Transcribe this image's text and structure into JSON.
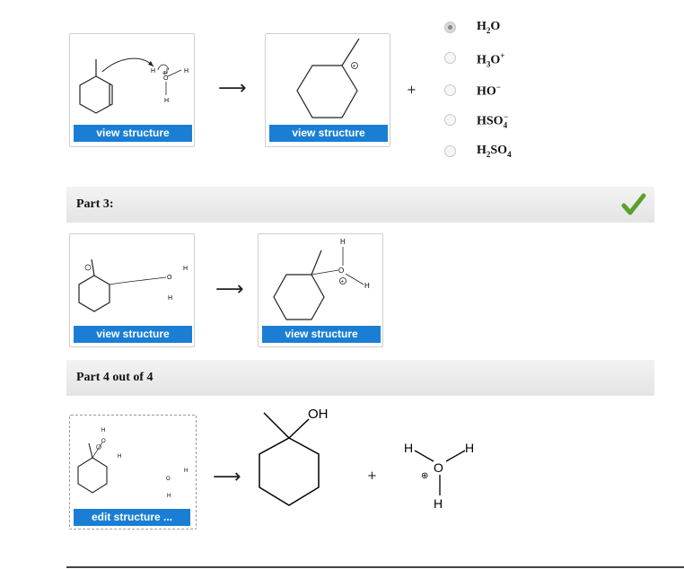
{
  "part2": {
    "reactant_card": {
      "button_label": "view structure"
    },
    "product_card": {
      "button_label": "view structure"
    },
    "arrow": "⟶",
    "plus": "+",
    "options": [
      {
        "base": "H",
        "sub": "2",
        "rest": "O",
        "sup": "",
        "checked": true
      },
      {
        "base": "H",
        "sub": "3",
        "rest": "O",
        "sup": "+",
        "checked": false
      },
      {
        "base": "HO",
        "sub": "",
        "rest": "",
        "sup": "−",
        "checked": false
      },
      {
        "base": "HSO",
        "sub": "4",
        "rest": "",
        "sup": "−",
        "checked": false
      },
      {
        "base": "H",
        "sub": "2",
        "rest": "SO",
        "sub2": "4",
        "checked": false
      }
    ]
  },
  "part3": {
    "title": "Part 3:",
    "status": "correct",
    "reactant_card": {
      "button_label": "view structure"
    },
    "product_card": {
      "button_label": "view structure"
    },
    "arrow": "⟶"
  },
  "part4": {
    "title": "Part 4 out of 4",
    "edit_card": {
      "button_label": "edit structure ..."
    },
    "arrow": "⟶",
    "plus": "+",
    "product_labels": {
      "oh": "OH",
      "h": "H",
      "o": "O",
      "charge": "⊕"
    }
  },
  "atom_labels": {
    "h": "H",
    "o": "O",
    "plus": "⊕"
  },
  "colors": {
    "button": "#1a7fd4",
    "check": "#5aa02c",
    "partbar": "#e8e8e8"
  }
}
